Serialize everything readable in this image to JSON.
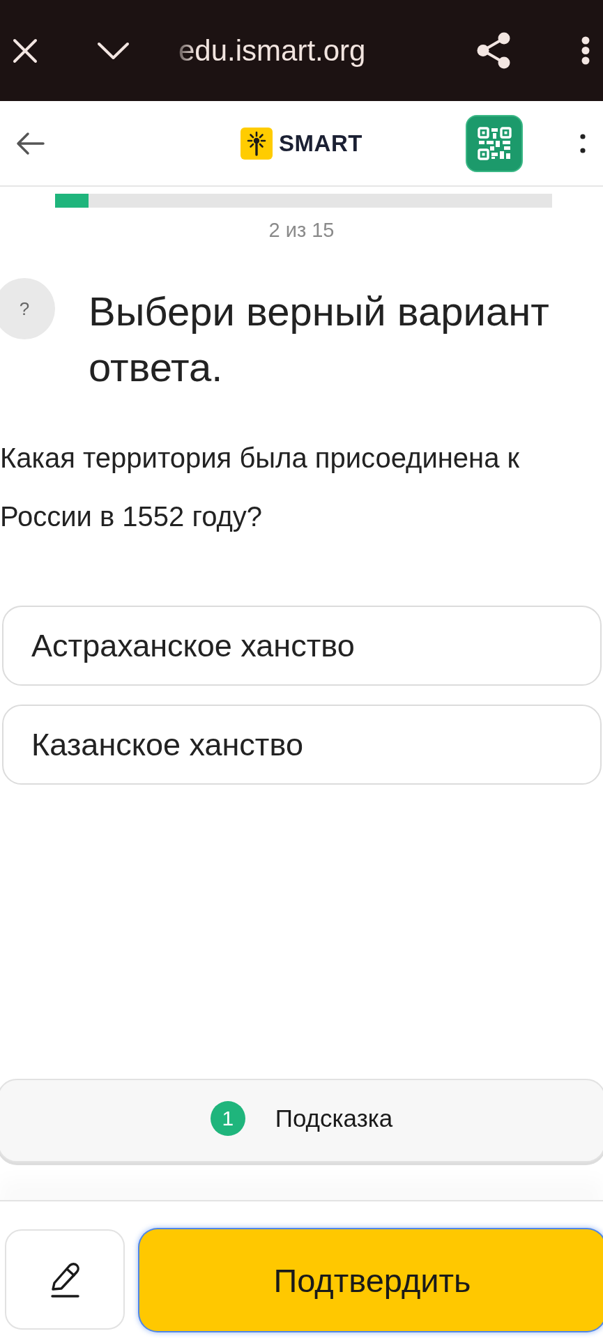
{
  "browser_bar": {
    "url": "edu.ismart.org"
  },
  "header": {
    "logo_text": "SMART"
  },
  "progress": {
    "level": 0.067,
    "label": "2 из 15"
  },
  "question": {
    "help_symbol": "?",
    "title": "Выбери верный вариант ответа.",
    "text": "Какая территория была присоединена к России в 1552 году?"
  },
  "answers": [
    {
      "label": "Астраханское ханство",
      "selected": false
    },
    {
      "label": "Казанское ханство",
      "selected": false
    }
  ],
  "hint": {
    "count": "1",
    "label": "Подсказка"
  },
  "actions": {
    "confirm": {
      "label": "Подтвердить",
      "focused": true
    }
  }
}
